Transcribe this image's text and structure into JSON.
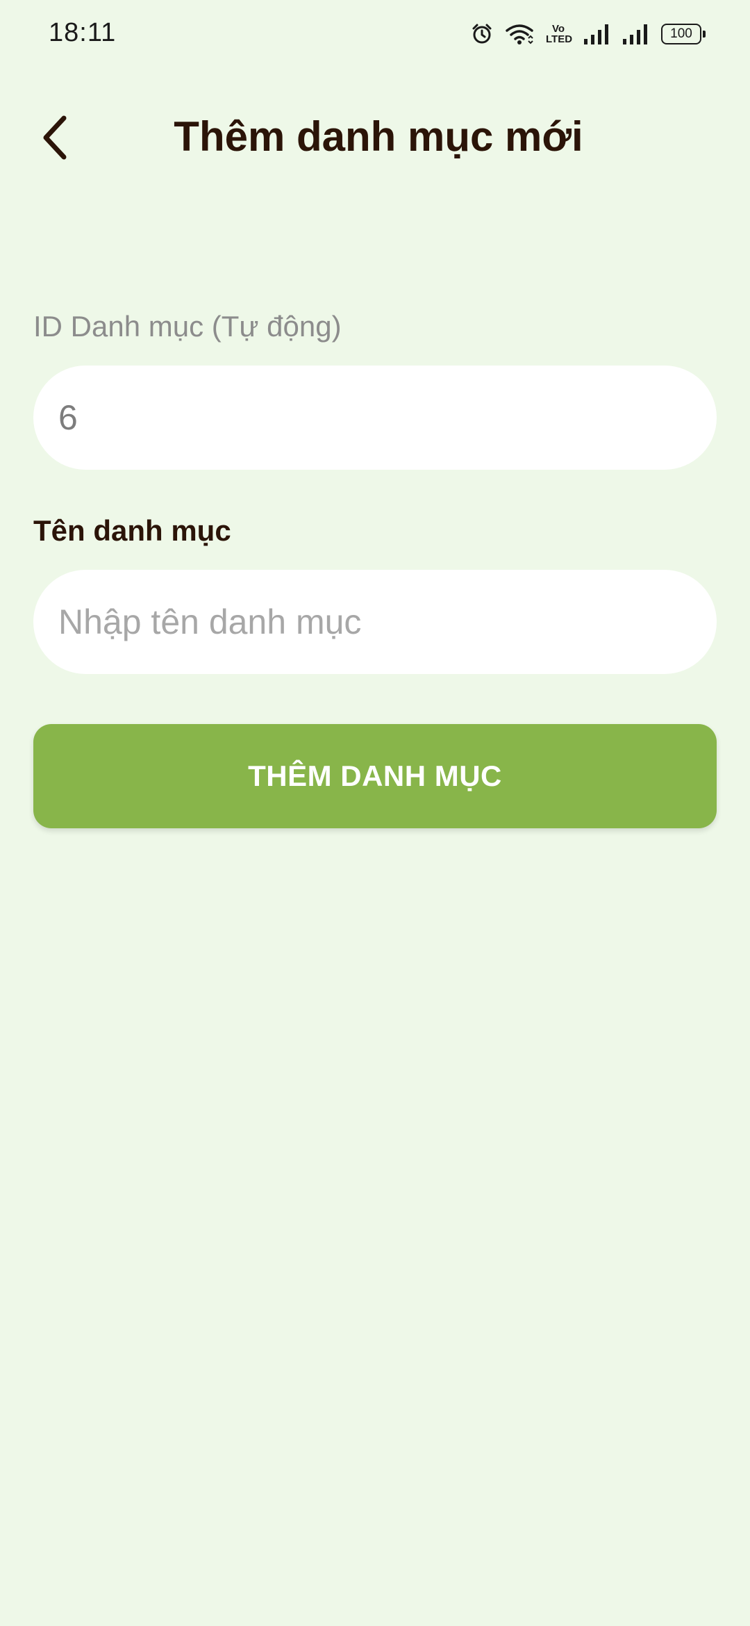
{
  "status_bar": {
    "time": "18:11",
    "volte_top": "Vo",
    "volte_bottom": "LTED",
    "battery": "100",
    "icons": [
      "alarm-icon",
      "wifi-icon",
      "volte-icon",
      "signal-icon",
      "signal-icon",
      "battery-icon"
    ]
  },
  "header": {
    "title": "Thêm danh mục mới",
    "back_icon": "chevron-left-icon"
  },
  "form": {
    "id_label": "ID Danh mục (Tự động)",
    "id_value": "6",
    "name_label": "Tên danh mục",
    "name_placeholder": "Nhập tên danh mục",
    "name_value": "",
    "submit_label": "THÊM DANH MỤC"
  },
  "colors": {
    "background": "#eef8e8",
    "accent": "#88b54a",
    "title": "#2b1408",
    "input_bg": "#ffffff"
  }
}
